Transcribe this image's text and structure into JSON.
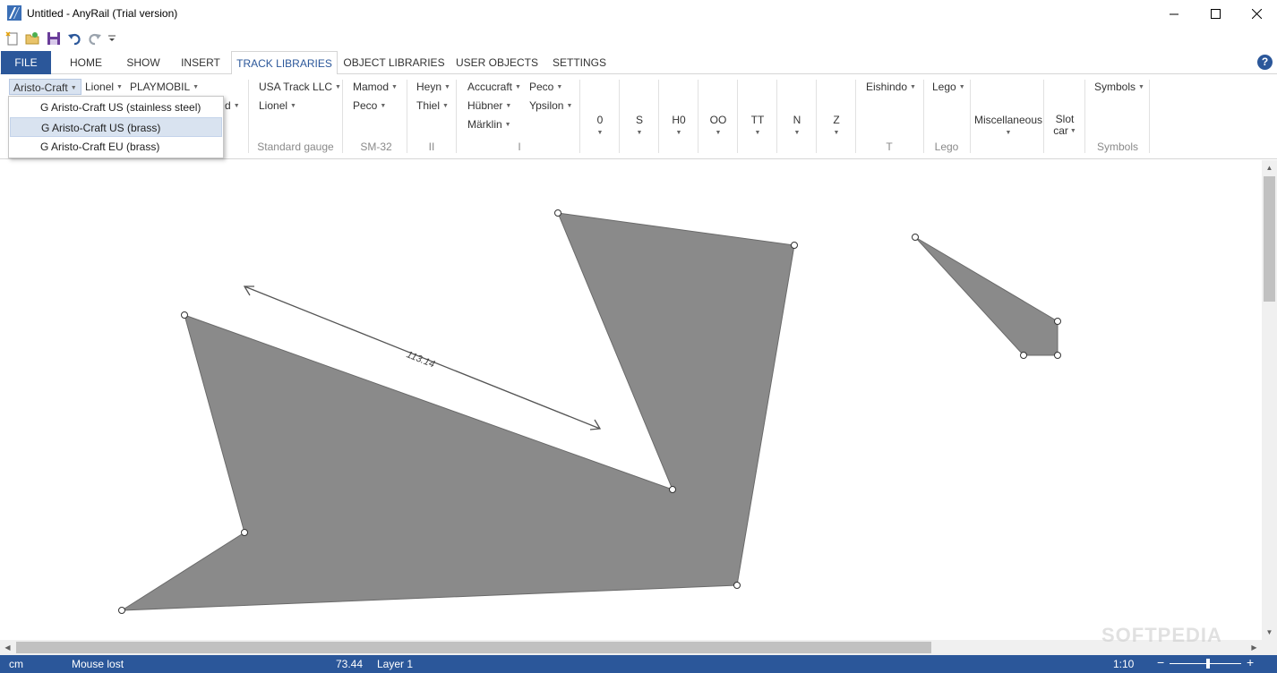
{
  "window": {
    "title": "Untitled - AnyRail (Trial version)"
  },
  "colors": {
    "accent": "#2b579a",
    "shape_fill": "#8a8a8a",
    "menu_highlight": "#d9e3f0"
  },
  "quick_access": {
    "items": [
      "new-file-icon",
      "open-file-icon",
      "save-icon",
      "undo-icon",
      "redo-icon",
      "customize-dropdown-icon"
    ]
  },
  "tabs": {
    "file": "FILE",
    "items": [
      "HOME",
      "SHOW",
      "INSERT",
      "TRACK LIBRARIES",
      "OBJECT LIBRARIES",
      "USER OBJECTS",
      "SETTINGS"
    ],
    "active": "TRACK LIBRARIES",
    "help": "?"
  },
  "ribbon": {
    "g_group": {
      "aristo": "Aristo-Craft",
      "lionel": "Lionel",
      "playmobil": "PLAYMOBIL",
      "hidden_partial": "d"
    },
    "standard_gauge": {
      "usa_track": "USA Track LLC",
      "lionel": "Lionel",
      "label": "Standard gauge"
    },
    "sm32": {
      "mamod": "Mamod",
      "peco": "Peco",
      "label": "SM-32"
    },
    "gauge_ii": {
      "heyn": "Heyn",
      "thiel": "Thiel",
      "label": "II"
    },
    "gauge_i": {
      "accucraft": "Accucraft",
      "peco": "Peco",
      "hubner": "Hübner",
      "ypsilon": "Ypsilon",
      "marklin": "Märklin",
      "label": "I"
    },
    "scales": [
      "0",
      "S",
      "H0",
      "OO",
      "TT",
      "N",
      "Z"
    ],
    "t_group": {
      "eishindo": "Eishindo",
      "label": "T"
    },
    "lego_group": {
      "lego": "Lego",
      "label": "Lego"
    },
    "misc": {
      "label": "Miscellaneous"
    },
    "slot": {
      "line1": "Slot",
      "line2": "car"
    },
    "symbols": {
      "button": "Symbols",
      "label": "Symbols"
    }
  },
  "dropdown": {
    "items": [
      {
        "label": "G Aristo-Craft US (stainless steel)",
        "highlighted": false
      },
      {
        "label": "G Aristo-Craft US (brass)",
        "highlighted": true
      },
      {
        "label": "G Aristo-Craft EU (brass)",
        "highlighted": false
      }
    ]
  },
  "canvas": {
    "measurement_label": "113.14"
  },
  "status": {
    "unit": "cm",
    "mouse": "Mouse lost",
    "value": "73.44",
    "layer": "Layer 1",
    "scale": "1:10",
    "zoom_minus": "−",
    "zoom_plus": "+"
  },
  "watermark": "SOFTPEDIA"
}
